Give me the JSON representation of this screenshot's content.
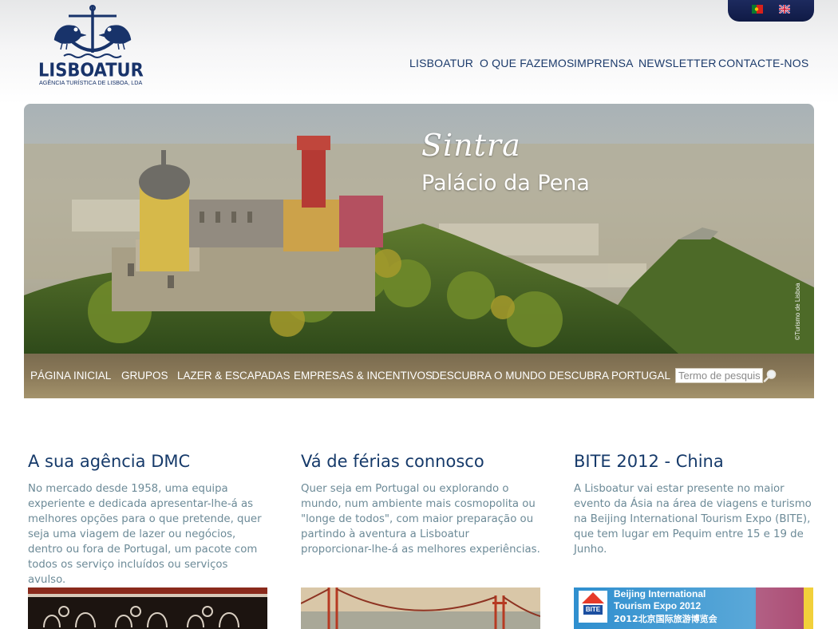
{
  "brand": {
    "name": "LISBOATUR",
    "tagline": "AGÊNCIA TURÍSTICA DE LISBOA, LDA",
    "color": "#18336a"
  },
  "languages": [
    {
      "name": "pt-flag-icon"
    },
    {
      "name": "uk-flag-icon"
    }
  ],
  "top_nav": [
    "LISBOATUR",
    "O QUE FAZEMOS",
    "IMPRENSA",
    "NEWSLETTER",
    "CONTACTE-NOS"
  ],
  "hero": {
    "title": "Sintra",
    "subtitle": "Palácio da Pena",
    "credit": "©Turismo de Lisboa"
  },
  "main_nav": [
    "PÁGINA INICIAL",
    "GRUPOS",
    "LAZER & ESCAPADAS",
    "EMPRESAS & INCENTIVOS",
    "DESCUBRA O MUNDO",
    "DESCUBRA PORTUGAL"
  ],
  "search": {
    "placeholder": "Termo de pesquisa",
    "icon": "magnifier-icon"
  },
  "columns": [
    {
      "title": "A sua agência DMC",
      "text": "No mercado desde 1958, uma equipa experiente e dedicada apresentar-lhe-á as melhores opções para o que pretende, quer seja uma viagem de lazer ou negócios, dentro ou fora de Portugal, um pacote com todos os serviço incluídos ou serviços avulso."
    },
    {
      "title": "Vá de férias connosco",
      "text": "Quer seja em Portugal ou explorando o mundo, num ambiente mais cosmopolita ou \"longe de todos\", com maior preparação ou partindo à aventura a Lisboatur proporcionar-lhe-á as melhores experiências."
    },
    {
      "title": "BITE 2012 - China",
      "text": "A Lisboatur vai estar presente no maior evento da Ásia na área de viagens e turismo na Beijing International Tourism Expo (BITE), que tem lugar em Pequim entre 15 e 19 de Junho."
    }
  ],
  "bite_banner": {
    "line1": "Beijing International",
    "line2": "Tourism Expo 2012",
    "line3": "2012北京国际旅游博览会",
    "logo_text": "BITE"
  },
  "colors": {
    "nav_bar": "#8b7a59",
    "heading": "#163a6a",
    "body_text": "#6c8a97",
    "lang_tab": "#1d2a5e"
  }
}
